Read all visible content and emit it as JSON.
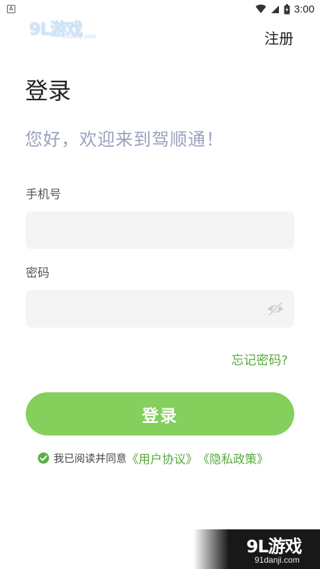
{
  "status_bar": {
    "left_icon": "A",
    "time": "3:00",
    "icons": [
      "wifi-icon",
      "signal-icon",
      "battery-icon"
    ]
  },
  "watermark_top": {
    "brand": "9L游戏",
    "url": "91danji.com"
  },
  "header": {
    "register_label": "注册"
  },
  "main": {
    "title": "登录",
    "welcome": "您好，欢迎来到驾顺通！",
    "phone": {
      "label": "手机号",
      "value": "",
      "placeholder": ""
    },
    "password": {
      "label": "密码",
      "value": "",
      "placeholder": "",
      "toggle_icon": "eye-off-icon"
    },
    "forgot_label": "忘记密码?",
    "login_label": "登录",
    "agreement": {
      "checked": true,
      "text": "我已阅读并同意",
      "user_agreement": "《用户协议》",
      "privacy_policy": "《隐私政策》"
    }
  },
  "watermark_bottom": {
    "brand": "9L游戏",
    "url": "91danji.com"
  },
  "colors": {
    "accent": "#85cf5d",
    "link": "#58a940",
    "welcome_text": "#9aa0bc",
    "input_bg": "#f4f4f4"
  }
}
